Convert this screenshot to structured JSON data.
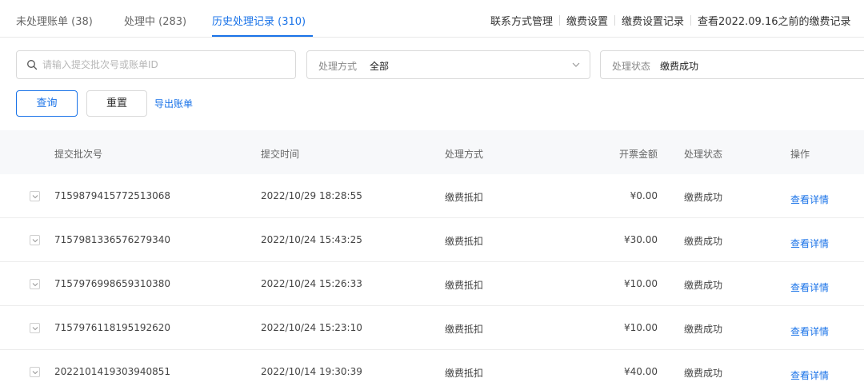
{
  "tabs": [
    {
      "label": "未处理账单 (38)"
    },
    {
      "label": "处理中 (283)"
    },
    {
      "label": "历史处理记录 (310)"
    }
  ],
  "active_tab": 2,
  "header_links": [
    "联系方式管理",
    "缴费设置",
    "缴费设置记录",
    "查看2022.09.16之前的缴费记录"
  ],
  "filters": {
    "search_placeholder": "请输入提交批次号或账单ID",
    "method_label": "处理方式",
    "method_value": "全部",
    "status_label": "处理状态",
    "status_value": "缴费成功"
  },
  "buttons": {
    "query": "查询",
    "reset": "重置",
    "export": "导出账单"
  },
  "table": {
    "headers": {
      "batch_id": "提交批次号",
      "time": "提交时间",
      "method": "处理方式",
      "amount": "开票金额",
      "status": "处理状态",
      "action": "操作"
    },
    "rows": [
      {
        "batch_id": "7159879415772513068",
        "time": "2022/10/29 18:28:55",
        "method": "缴费抵扣",
        "amount": "¥0.00",
        "status": "缴费成功",
        "action": "查看详情"
      },
      {
        "batch_id": "7157981336576279340",
        "time": "2022/10/24 15:43:25",
        "method": "缴费抵扣",
        "amount": "¥30.00",
        "status": "缴费成功",
        "action": "查看详情"
      },
      {
        "batch_id": "7157976998659310380",
        "time": "2022/10/24 15:26:33",
        "method": "缴费抵扣",
        "amount": "¥10.00",
        "status": "缴费成功",
        "action": "查看详情"
      },
      {
        "batch_id": "7157976118195192620",
        "time": "2022/10/24 15:23:10",
        "method": "缴费抵扣",
        "amount": "¥10.00",
        "status": "缴费成功",
        "action": "查看详情"
      },
      {
        "batch_id": "2022101419303940851",
        "time": "2022/10/14 19:30:39",
        "method": "缴费抵扣",
        "amount": "¥40.00",
        "status": "缴费成功",
        "action": "查看详情"
      }
    ]
  },
  "colors": {
    "accent": "#1a73e8",
    "header_bg": "#f7f8fa",
    "border": "#d9d9d9"
  },
  "icons": [
    "search-icon",
    "chevron-down-icon",
    "expand-row-icon"
  ]
}
